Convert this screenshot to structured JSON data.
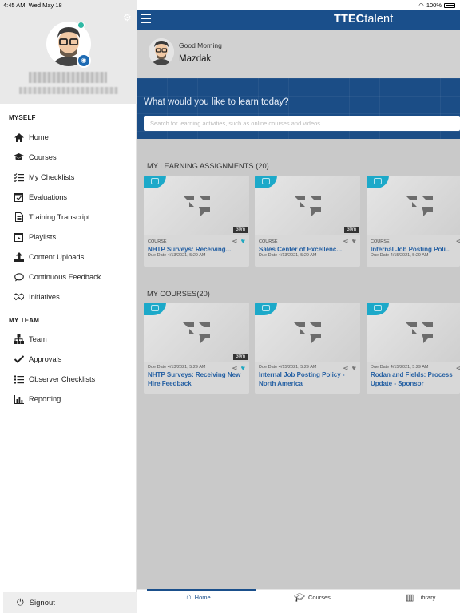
{
  "status_bar": {
    "time": "4:45 AM",
    "date": "Wed May 18",
    "battery": "100%"
  },
  "brand": {
    "name_bold": "TTEC",
    "name_rest": "talent"
  },
  "greeting": {
    "salutation": "Good Morning",
    "name": "Mazdak"
  },
  "banner": {
    "question": "What would you like to learn today?",
    "search_placeholder": "Search for learning activities, such as online courses and videos."
  },
  "drawer": {
    "section_myself": "MYSELF",
    "myself_items": [
      {
        "label": "Home",
        "icon": "home-icon"
      },
      {
        "label": "Courses",
        "icon": "graduation-cap-icon"
      },
      {
        "label": "My Checklists",
        "icon": "checklist-icon"
      },
      {
        "label": "Evaluations",
        "icon": "calendar-check-icon"
      },
      {
        "label": "Training Transcript",
        "icon": "document-icon"
      },
      {
        "label": "Playlists",
        "icon": "playlist-icon"
      },
      {
        "label": "Content Uploads",
        "icon": "upload-icon"
      },
      {
        "label": "Continuous Feedback",
        "icon": "speech-bubble-icon"
      },
      {
        "label": "Initiatives",
        "icon": "handshake-icon"
      }
    ],
    "section_team": "MY TEAM",
    "team_items": [
      {
        "label": "Team",
        "icon": "org-chart-icon"
      },
      {
        "label": "Approvals",
        "icon": "checkmark-icon"
      },
      {
        "label": "Observer Checklists",
        "icon": "list-icon"
      },
      {
        "label": "Reporting",
        "icon": "bar-chart-icon"
      }
    ],
    "signout": "Signout"
  },
  "assignments": {
    "title": "MY LEARNING ASSIGNMENTS (20)",
    "cards": [
      {
        "type": "COURSE",
        "title": "NHTP Surveys: Receiving...",
        "due": "Due Date 4/13/2021, 5:29 AM",
        "duration": "30m",
        "favorite": true
      },
      {
        "type": "COURSE",
        "title": "Sales Center of Excellenc...",
        "due": "Due Date 4/13/2021, 5:29 AM",
        "duration": "30m",
        "favorite": false
      },
      {
        "type": "COURSE",
        "title": "Internal Job Posting Poli...",
        "due": "Due Date 4/15/2021, 5:29 AM",
        "duration": "",
        "favorite": false
      }
    ]
  },
  "courses": {
    "title": "MY COURSES(20)",
    "cards": [
      {
        "title": "NHTP Surveys: Receiving New Hire Feedback",
        "due": "Due Date 4/13/2021, 5:29 AM",
        "duration": "30m",
        "favorite": true
      },
      {
        "title": "Internal Job Posting Policy - North America",
        "due": "Due Date 4/15/2021, 5:29 AM",
        "duration": "",
        "favorite": false
      },
      {
        "title": "Rodan and Fields: Process Update - Sponsor",
        "due": "Due Date 4/15/2021, 5:29 AM",
        "duration": "",
        "favorite": false
      }
    ]
  },
  "bottom_nav": [
    {
      "label": "Home",
      "icon": "home-icon",
      "active": true
    },
    {
      "label": "Courses",
      "icon": "graduation-cap-icon",
      "active": false
    },
    {
      "label": "Library",
      "icon": "books-icon",
      "active": false
    }
  ],
  "colors": {
    "brand_blue": "#1a4f8b",
    "accent_teal": "#1ca9c9",
    "link_blue": "#2560a3"
  }
}
